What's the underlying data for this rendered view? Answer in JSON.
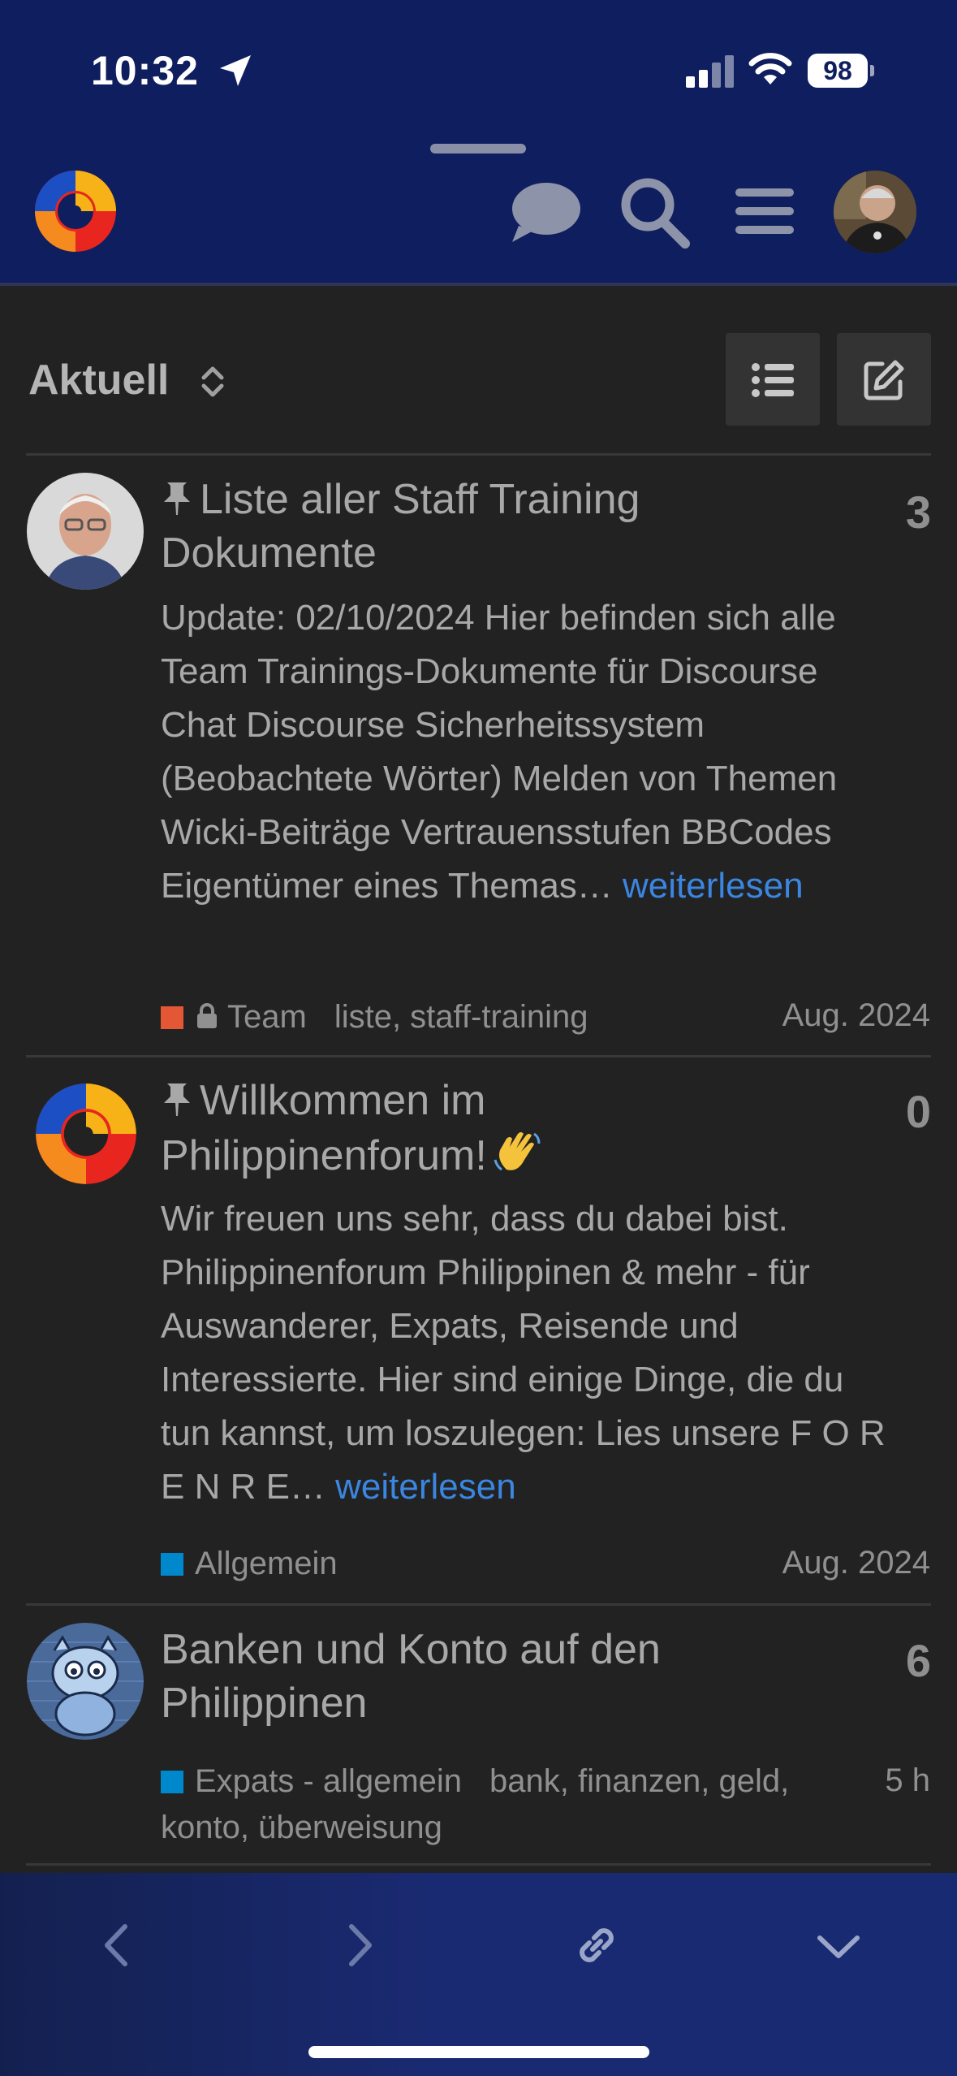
{
  "status_bar": {
    "time": "10:32",
    "battery": "98"
  },
  "header": {
    "logo_icon": "forum-swirl-logo",
    "icons": [
      "chat-bubble-icon",
      "search-icon",
      "hamburger-menu-icon",
      "user-avatar"
    ]
  },
  "filter": {
    "title": "Aktuell"
  },
  "topics": [
    {
      "pinned": true,
      "title": "Liste aller Staff Training Dokumente",
      "reply_count": "3",
      "excerpt": "Update: 02/10/2024 Hier befinden sich alle Team Trainings-Dokumente für Discourse Chat Discourse Sicherheitssystem (Beobachtete Wörter) Melden von Themen Wicki-Beiträge Vertrauensstufen BBCodes Eigentümer eines Themas…",
      "read_more": "weiterlesen",
      "category": "Team",
      "category_color": "#e45735",
      "category_locked": true,
      "tags": "liste, staff-training",
      "date": "Aug. 2024"
    },
    {
      "pinned": true,
      "title": "Willkommen im Philippinenforum!",
      "reply_count": "0",
      "excerpt": "Wir freuen uns sehr, dass du dabei bist. Philippinenforum Philippinen & mehr - für Auswanderer, Expats, Reisende und Interessierte. Hier sind einige Dinge, die du tun kannst, um loszulegen: Lies unsere F O R E N R E…",
      "read_more": "weiterlesen",
      "category": "Allgemein",
      "category_color": "#0088cc",
      "date": "Aug. 2024"
    },
    {
      "pinned": false,
      "title": "Banken und Konto auf den Philippinen",
      "reply_count": "6",
      "category": "Expats - allgemein",
      "category_color": "#0088cc",
      "tags_line1": "bank, finanzen, geld,",
      "tags_line2": "konto, überweisung",
      "date": "5 h"
    }
  ],
  "colors": {
    "header_bg": "#0f1e5e",
    "page_bg": "#222222",
    "link": "#3a86e0"
  }
}
